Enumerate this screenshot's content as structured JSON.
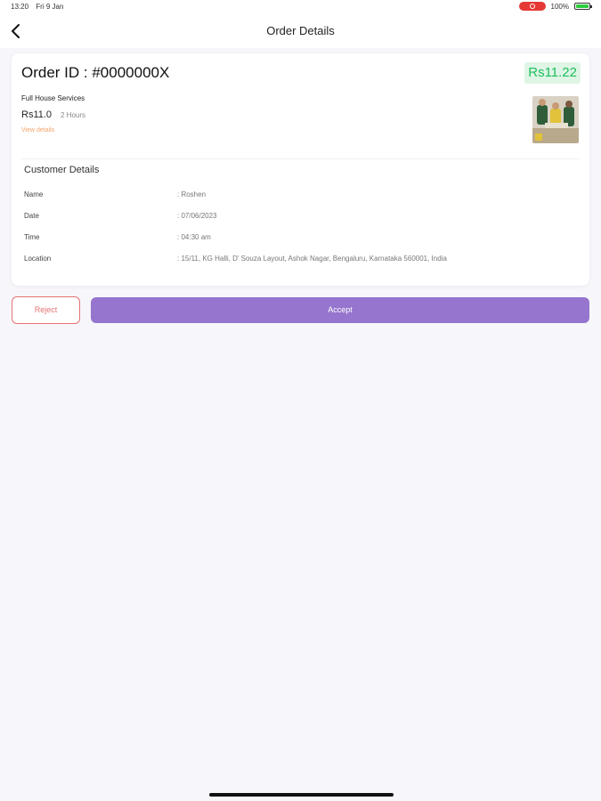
{
  "status_bar": {
    "time": "13:20",
    "date": "Fri 9 Jan",
    "battery_text": "100%"
  },
  "nav": {
    "title": "Order Details"
  },
  "order": {
    "id_label": "Order ID : #0000000X",
    "total_price": "Rs11.22",
    "service_name": "Full House Services",
    "service_price": "Rs11.0",
    "service_duration": "2 Hours",
    "view_details_label": "View details"
  },
  "customer": {
    "heading": "Customer Details",
    "rows": [
      {
        "label": "Name",
        "value": ": Roshen"
      },
      {
        "label": "Date",
        "value": ": 07/06/2023"
      },
      {
        "label": "Time",
        "value": ": 04:30 am"
      },
      {
        "label": "Location",
        "value": ": 15/11, KG Halli, D' Souza Layout, Ashok Nagar, Bengaluru, Karnataka 560001, India"
      }
    ]
  },
  "actions": {
    "reject_label": "Reject",
    "accept_label": "Accept"
  },
  "colors": {
    "accent": "#9575cd",
    "reject": "#e57373",
    "price_green": "#1fbf5b",
    "view_details": "#f4a46b"
  }
}
